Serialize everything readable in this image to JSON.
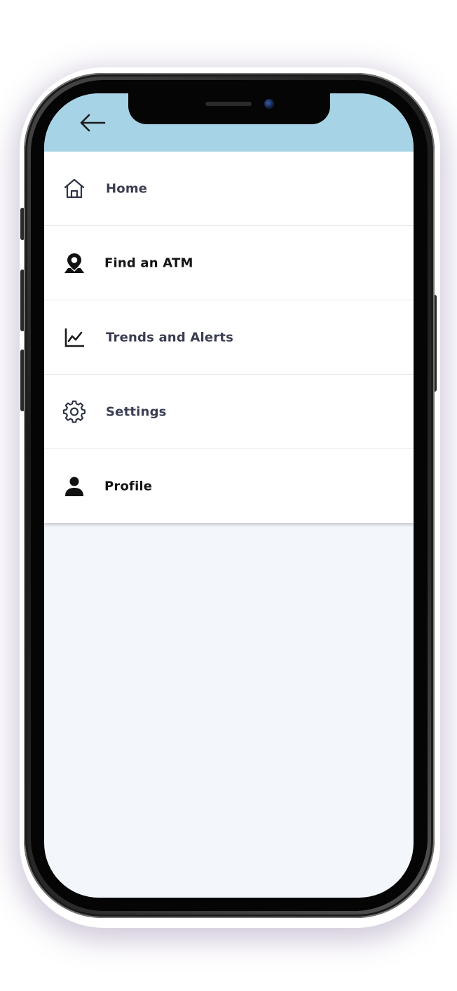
{
  "header": {
    "back_icon": "arrow-left-icon",
    "bg_color": "#a7d3e6"
  },
  "menu": {
    "items": [
      {
        "label": "Home",
        "icon": "home-icon"
      },
      {
        "label": "Find an ATM",
        "icon": "map-pin-person-icon"
      },
      {
        "label": "Trends and Alerts",
        "icon": "trend-chart-icon"
      },
      {
        "label": "Settings",
        "icon": "gear-icon"
      },
      {
        "label": "Profile",
        "icon": "user-icon"
      }
    ]
  },
  "colors": {
    "screen_background": "#f3f7fb",
    "label_primary": "#141414",
    "label_secondary": "#3a3d52"
  }
}
